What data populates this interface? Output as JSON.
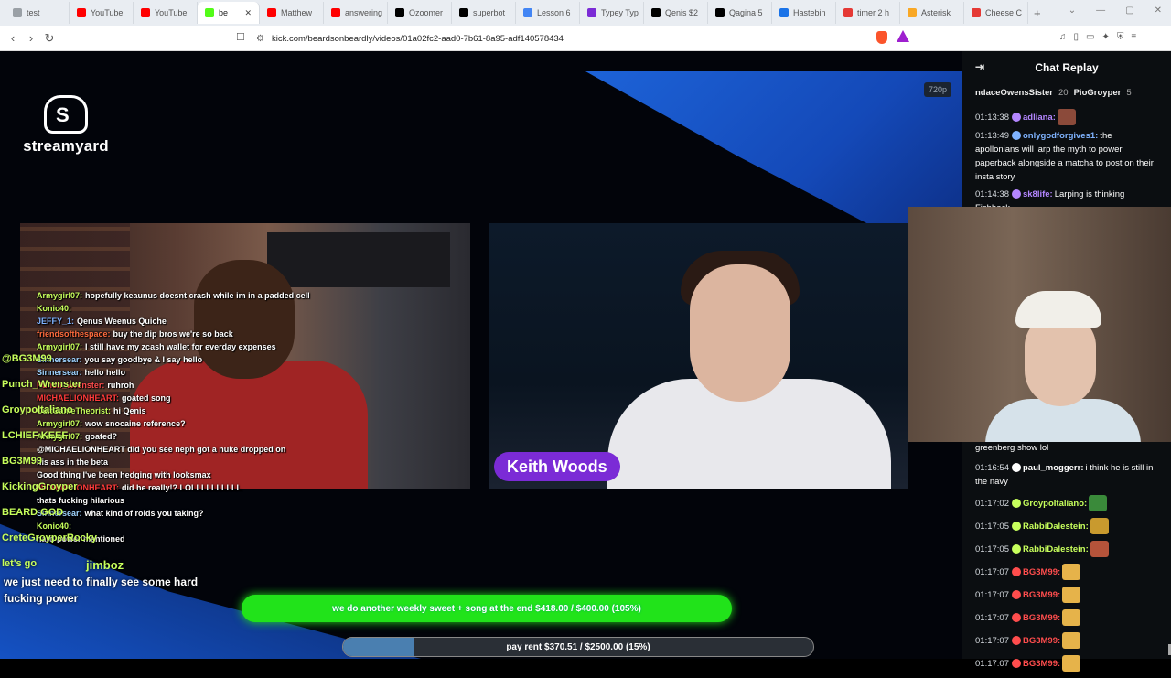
{
  "browser": {
    "tabs": [
      {
        "label": "test",
        "color": "#9aa0a6"
      },
      {
        "label": "YouTube",
        "color": "#ff0000"
      },
      {
        "label": "YouTube",
        "color": "#ff0000"
      },
      {
        "label": "be",
        "color": "#53fc18",
        "active": true
      },
      {
        "label": "Matthew",
        "color": "#ff0000"
      },
      {
        "label": "answering",
        "color": "#ff0000"
      },
      {
        "label": "Ozoomer",
        "color": "#000000"
      },
      {
        "label": "superbot",
        "color": "#000000"
      },
      {
        "label": "Lesson 6",
        "color": "#4285f4"
      },
      {
        "label": "Typey Typ",
        "color": "#7b2bd6"
      },
      {
        "label": "Qenis $2",
        "color": "#000000"
      },
      {
        "label": "Qagina 5",
        "color": "#000000"
      },
      {
        "label": "Hastebin",
        "color": "#1a73e8"
      },
      {
        "label": "timer 2 h",
        "color": "#e53935"
      },
      {
        "label": "Asterisk",
        "color": "#f9a825"
      },
      {
        "label": "Cheese C",
        "color": "#e53935"
      }
    ],
    "new_tab": "+",
    "url": "kick.com/beardsonbeardly/videos/01a02fc2-aad0-7b61-8a95-adf140578434"
  },
  "video": {
    "logo_text": "streamyard",
    "quality": "720p",
    "name_plate": "Keith Woods",
    "overlay_chat": [
      {
        "user": "Armygirl07:",
        "text": "hopefully keaunus doesnt crash while im in a padded cell",
        "color": "#c7ff5c"
      },
      {
        "user": "Konic40:",
        "text": "",
        "color": "#c7ff5c"
      },
      {
        "user": "JEFFY_1:",
        "text": "Qenus Weenus Quiche",
        "color": "#7fb3ff"
      },
      {
        "user": "friendsofthespace:",
        "text": "buy the dip bros we're so back",
        "color": "#ff6b3d"
      },
      {
        "user": "Armygirl07:",
        "text": "I still have my zcash wallet for everday expenses",
        "color": "#c7ff5c"
      },
      {
        "user": "Sinnersear:",
        "text": "you say goodbye & I say hello",
        "color": "#9fd3ff"
      },
      {
        "user": "Sinnersear:",
        "text": "hello hello",
        "color": "#9fd3ff"
      },
      {
        "user": "Punch_Wrenster:",
        "text": "ruhroh",
        "color": "#ff4d4d"
      },
      {
        "user": "MICHAELIONHEART:",
        "text": "goated song",
        "color": "#ff3b3b"
      },
      {
        "user": "CultGameTheorist:",
        "text": "hi Qenis",
        "color": "#c7ff5c"
      },
      {
        "user": "Armygirl07:",
        "text": "wow snocaine reference?",
        "color": "#c7ff5c"
      },
      {
        "user": "Armygirl07:",
        "text": "goated?",
        "color": "#c7ff5c"
      },
      {
        "user": "",
        "text": "@MICHAELIONHEART did you see neph got a nuke dropped on",
        "color": "#c7ff5c"
      },
      {
        "user": "",
        "text": "his ass in the beta",
        "color": "#c7ff5c"
      },
      {
        "user": "",
        "text": "Good thing I've been hedging with looksmax",
        "color": "#c7ff5c"
      },
      {
        "user": "MICHAELIONHEART:",
        "text": "did he really!? LOLLLLLLLLLL",
        "color": "#ff3b3b"
      },
      {
        "user": "",
        "text": "thats fucking hilarious",
        "color": "#c7ff5c"
      },
      {
        "user": "Sinnersear:",
        "text": "what kind of roids you taking?",
        "color": "#9fd3ff"
      },
      {
        "user": "Konic40:",
        "text": "",
        "color": "#c7ff5c"
      },
      {
        "user": "",
        "text": "hard power mentioned",
        "color": "#c7ff5c"
      }
    ],
    "side_names": [
      "@BG3M99",
      "Punch_Wrenster",
      "GroypoItaliano",
      "LCHIEF KEEF",
      "BG3M99",
      "KickingGroyper",
      "BEARD GOD",
      "CreteGroyperRocky",
      "let's go"
    ],
    "bottom_user": "jimboz",
    "bottom_message": "we just need to finally see some hard fucking power",
    "goal_top": "we do another weekly sweet + song at the end $418.00 / $400.00 (105%)",
    "goal_bottom": "pay rent $370.51 / $2500.00 (15%)",
    "goal_bottom_progress": 0.15
  },
  "chat": {
    "title": "Chat Replay",
    "pinned": [
      {
        "name": "ndaceOwensSister",
        "count": "20"
      },
      {
        "name": "PioGroyper",
        "count": "5"
      }
    ],
    "upper_messages": [
      {
        "time": "01:13:38",
        "user": "adliana:",
        "color": "#b486ff",
        "text": "",
        "emote": "#8b4a3a"
      },
      {
        "time": "01:13:49",
        "user": "onlygodforgives1:",
        "color": "#7fb3ff",
        "text": "the apollonians will larp the myth to power paperback alongside a matcha to post on their insta story"
      },
      {
        "time": "01:14:38",
        "user": "sk8life:",
        "color": "#b486ff",
        "text": "Larping is thinking Fishback"
      }
    ],
    "lower_messages": [
      {
        "time": "",
        "user": "",
        "color": "#ffffff",
        "text": "greenberg show lol"
      },
      {
        "time": "01:16:54",
        "user": "paul_moggerr:",
        "color": "#ffffff",
        "text": "i think he is still in the navy"
      },
      {
        "time": "01:17:02",
        "user": "GroypoItaliano:",
        "color": "#c7ff5c",
        "text": "",
        "emote": "#3a8a3a"
      },
      {
        "time": "01:17:05",
        "user": "RabbiDalestein:",
        "color": "#c7ff5c",
        "text": "",
        "emote": "#c99a2e"
      },
      {
        "time": "01:17:05",
        "user": "RabbiDalestein:",
        "color": "#c7ff5c",
        "text": "",
        "emote": "#b5533a"
      },
      {
        "time": "01:17:07",
        "user": "BG3M99:",
        "color": "#ff4d4d",
        "text": "",
        "emote": "#e6b34a"
      },
      {
        "time": "01:17:07",
        "user": "BG3M99:",
        "color": "#ff4d4d",
        "text": "",
        "emote": "#e6b34a"
      },
      {
        "time": "01:17:07",
        "user": "BG3M99:",
        "color": "#ff4d4d",
        "text": "",
        "emote": "#e6b34a"
      },
      {
        "time": "01:17:07",
        "user": "BG3M99:",
        "color": "#ff4d4d",
        "text": "",
        "emote": "#e6b34a"
      },
      {
        "time": "01:17:07",
        "user": "BG3M99:",
        "color": "#ff4d4d",
        "text": "",
        "emote": "#e6b34a"
      }
    ]
  }
}
